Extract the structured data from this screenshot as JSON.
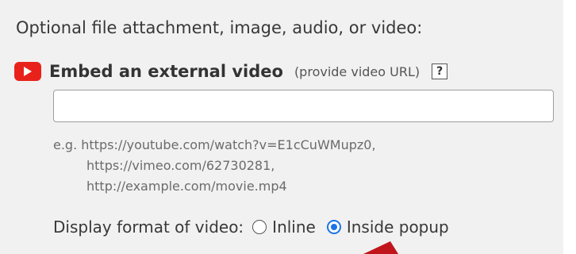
{
  "section": {
    "heading": "Optional file attachment, image, audio, or video:"
  },
  "embed": {
    "icon": "youtube-play-icon",
    "icon_color": "#e8221b",
    "title": "Embed an external video",
    "hint": "(provide video URL)",
    "help_label": "?"
  },
  "url_input": {
    "value": "",
    "placeholder": ""
  },
  "examples": {
    "line1": "e.g. https://youtube.com/watch?v=E1cCuWMupz0,",
    "line2": "https://vimeo.com/62730281,",
    "line3": "http://example.com/movie.mp4"
  },
  "display_format": {
    "label": "Display format of video:",
    "options": [
      {
        "label": "Inline",
        "selected": false
      },
      {
        "label": "Inside popup",
        "selected": true
      }
    ],
    "accent_color": "#1a73e8"
  },
  "annotation": {
    "arrow_color": "#c0161b"
  }
}
